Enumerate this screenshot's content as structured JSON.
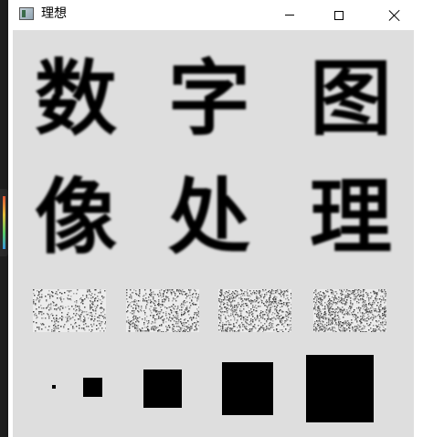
{
  "window": {
    "title": "理想"
  },
  "canvas": {
    "characters": [
      "数",
      "字",
      "图",
      "像",
      "处",
      "理"
    ],
    "noise_patches": [
      {
        "density": 0.3
      },
      {
        "density": 0.45
      },
      {
        "density": 0.55
      },
      {
        "density": 0.65
      }
    ],
    "squares": [
      1,
      2,
      3,
      4,
      5
    ]
  },
  "colors": {
    "canvas_background": "#dedede",
    "ink": "#000000",
    "titlebar": "#ffffff"
  },
  "icons": {
    "app": "app-icon",
    "minimize": "minimize-icon",
    "maximize": "maximize-icon",
    "close": "close-icon"
  }
}
